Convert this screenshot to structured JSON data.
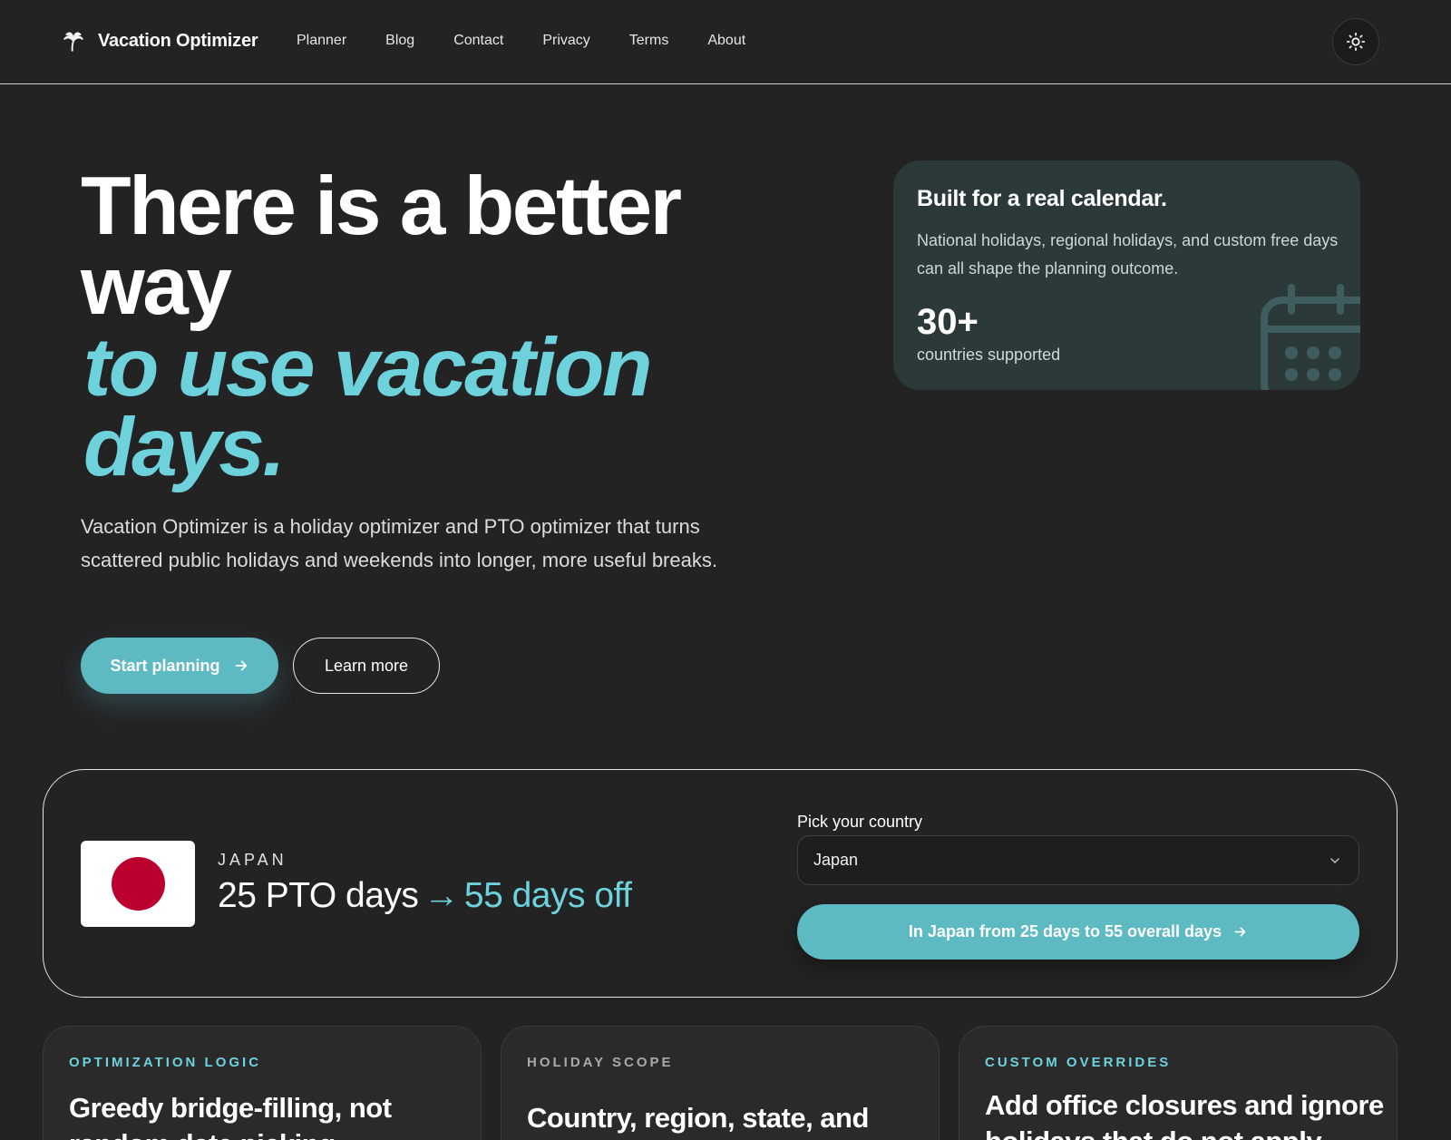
{
  "nav": {
    "brand": "Vacation Optimizer",
    "links": [
      {
        "label": "Planner"
      },
      {
        "label": "Blog"
      },
      {
        "label": "Contact"
      },
      {
        "label": "Privacy"
      },
      {
        "label": "Terms"
      },
      {
        "label": "About"
      }
    ],
    "theme_toggle_icon": "sun-icon"
  },
  "hero": {
    "title_line1": "There is a better",
    "title_line2": "way",
    "accent_line1": "to use vacation",
    "accent_line2": "days.",
    "description": "Vacation Optimizer is a holiday optimizer and PTO optimizer that turns scattered public holidays and weekends into longer, more useful breaks.",
    "primary_button": "Start planning",
    "secondary_button": "Learn more"
  },
  "calendar_card": {
    "title": "Built for a real calendar.",
    "description": "National holidays, regional holidays, and custom free days can all shape the planning outcome.",
    "stat_value": "30+",
    "stat_label": "countries supported"
  },
  "country_panel": {
    "country_label": "JAPAN",
    "pto_text": "25 PTO days",
    "off_text": "55 days off",
    "pick_label": "Pick your country",
    "selected_country": "Japan",
    "cta": "In Japan from 25 days to 55 overall days"
  },
  "features": [
    {
      "eyebrow": "OPTIMIZATION LOGIC",
      "title": "Greedy bridge-filling, not random date picking."
    },
    {
      "eyebrow": "HOLIDAY SCOPE",
      "title": "Country, region, state, and custom holidays."
    },
    {
      "eyebrow": "CUSTOM OVERRIDES",
      "title": "Add office closures and ignore holidays that do not apply."
    }
  ],
  "colors": {
    "accent": "#6dd2dc",
    "button_teal": "#5dbac2",
    "background": "#232324",
    "card_teal": "#2b3939",
    "flag_red": "#bc002d"
  }
}
